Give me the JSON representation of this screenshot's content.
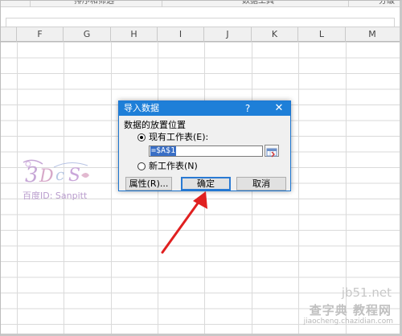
{
  "ribbon": {
    "groups": [
      "排序和筛选",
      "数据工具",
      "分级"
    ]
  },
  "columns": [
    "F",
    "G",
    "H",
    "I",
    "J",
    "K",
    "L",
    "M"
  ],
  "dialog": {
    "title": "导入数据",
    "help": "?",
    "close": "✕",
    "section_label": "数据的放置位置",
    "option_existing": "现有工作表(E):",
    "ref_value": "=$A$1",
    "option_new": "新工作表(N)",
    "properties_button": "属性(R)...",
    "ok_button": "确定",
    "cancel_button": "取消"
  },
  "watermark": {
    "baidu_id": "百度ID: Sanpitt"
  },
  "brand": {
    "url": "jb51.net",
    "name": "查字典 教程网",
    "sub": "jiaocheng.chazidian.com"
  },
  "colors": {
    "title_bar": "#1e7fd8",
    "arrow": "#e02020",
    "selection": "#3a6fc6"
  }
}
